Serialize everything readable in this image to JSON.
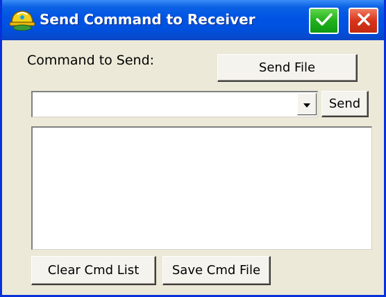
{
  "window": {
    "title": "Send Command to Receiver",
    "icon": "hardhat-satellite-icon",
    "ok_icon": "checkmark-icon",
    "close_icon": "close-x-icon"
  },
  "form": {
    "command_label": "Command to Send:",
    "send_file_label": "Send File",
    "command_value": "",
    "send_label": "Send",
    "dropdown_icon": "dropdown-arrow-icon"
  },
  "command_list": {
    "items": []
  },
  "footer": {
    "clear_label": "Clear Cmd List",
    "save_label": "Save Cmd File"
  },
  "colors": {
    "titlebar": "#0054e3",
    "ok_green": "#22b11c",
    "close_red": "#d8341a",
    "dialog_bg": "#ece9d8"
  }
}
